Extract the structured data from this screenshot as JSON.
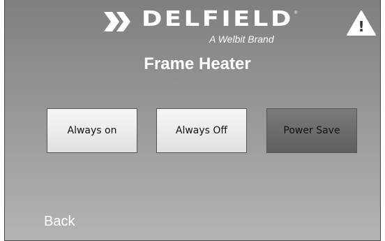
{
  "brand": {
    "name": "DELFIELD",
    "registered_mark": "®",
    "tagline": "A Welbit Brand"
  },
  "screen": {
    "title": "Frame Heater"
  },
  "warning": {
    "symbol": "!",
    "icon": "warning-triangle-icon"
  },
  "options": [
    {
      "label": "Always on",
      "selected": false
    },
    {
      "label": "Always Off",
      "selected": false
    },
    {
      "label": "Power Save",
      "selected": true
    }
  ],
  "footer": {
    "back_label": "Back"
  },
  "colors": {
    "selected_button": "#696969",
    "unselected_button": "#ececec",
    "text_on_background": "#ffffff"
  }
}
